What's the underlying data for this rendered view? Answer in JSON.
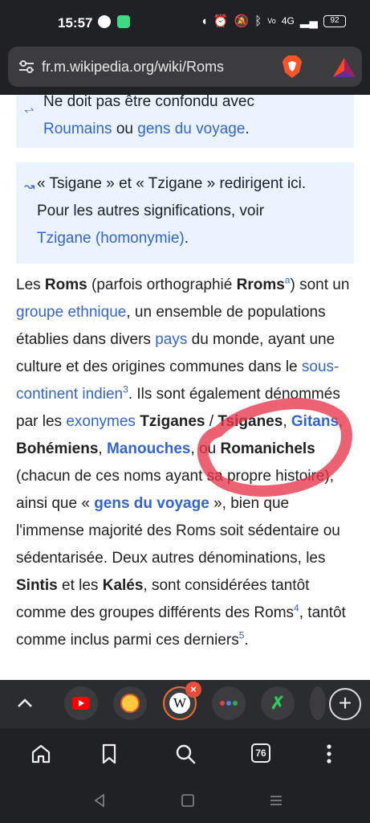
{
  "status_bar": {
    "time": "15:57",
    "network": "4G",
    "battery": "92"
  },
  "browser": {
    "url": "fr.m.wikipedia.org/wiki/Roms",
    "tab_count": "76"
  },
  "article": {
    "hatnote1": {
      "text": "Ne doit pas être confondu avec",
      "link1": "Roumains",
      "conj": "ou",
      "link2": "gens du voyage",
      "end": "."
    },
    "hatnote2": {
      "line1": "« Tsigane » et « Tzigane » redirigent ici.",
      "line2": "Pour les autres significations, voir",
      "link": "Tzigane (homonymie)",
      "end": "."
    },
    "p": {
      "t1": "Les ",
      "b_roms": "Roms",
      "t2": " (parfois orthographié ",
      "b_rroms": "Rroms",
      "sup_a": "a",
      "t3": ") sont un ",
      "l_groupe": "groupe ethnique",
      "t4": ", un ensemble de populations établies dans divers ",
      "l_pays": "pays",
      "t5": " du monde, ayant une culture et des origines communes dans le ",
      "l_sous": "sous-continent indien",
      "sup_3": "3",
      "t6": ". Ils sont également dénommés par les ",
      "l_exo": "exonymes",
      "t7": " ",
      "b_tzig": "Tziganes",
      "t8": " / ",
      "b_tsig": "Tsiganes",
      "t9": ", ",
      "bl_gitans": "Gitans",
      "t10": ", ",
      "b_boh": "Bohémiens",
      "t11": ", ",
      "bl_man": "Manouches",
      "t12": ", ou ",
      "b_roma": "Romanichels",
      "t13": " (chacun de ces noms ayant sa propre histoire), ainsi que « ",
      "bl_gens": "gens du voyage",
      "t14": " », bien que l'immense majorité des Roms soit sédentaire ou sédentarisée. Deux autres dénominations, les ",
      "b_sintis": "Sintis",
      "t15": " et les ",
      "b_kales": "Kalés",
      "t16": ", sont considérées tantôt comme des groupes différents des Roms",
      "sup_4": "4",
      "t17": ", tantôt comme inclus parmi ces derniers",
      "sup_5": "5",
      "t18": "."
    }
  },
  "tabs": {
    "active_letter": "W",
    "close": "×",
    "plus": "+"
  },
  "icons": {
    "chevron": "chevron-up-icon",
    "home": "home-icon",
    "bookmark": "bookmark-icon",
    "search": "search-icon",
    "menu": "more-vert-icon"
  }
}
